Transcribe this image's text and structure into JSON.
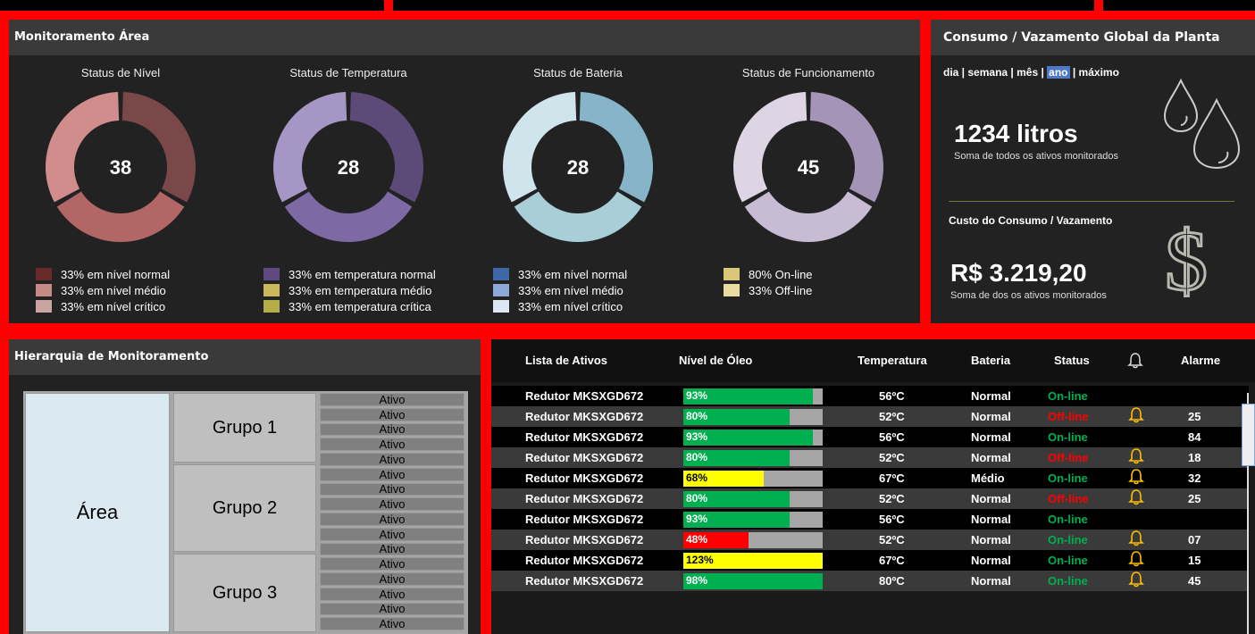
{
  "monitor": {
    "title": "Monitoramento Área",
    "donuts": [
      {
        "title": "Status de Nível",
        "center": "38",
        "segments": [
          {
            "value": 33,
            "color": "#7a4848"
          },
          {
            "value": 33,
            "color": "#b36666"
          },
          {
            "value": 33,
            "color": "#d18c8c"
          }
        ],
        "legend": [
          {
            "label": "33% em nível normal",
            "color": "#6a2a2a"
          },
          {
            "label": "33% em nível médio",
            "color": "#c48a84"
          },
          {
            "label": "33% em nível crítico",
            "color": "#c9a4a0"
          }
        ]
      },
      {
        "title": "Status de Temperatura",
        "center": "28",
        "segments": [
          {
            "value": 33,
            "color": "#5c4a78"
          },
          {
            "value": 33,
            "color": "#7d6aa5"
          },
          {
            "value": 33,
            "color": "#a696c6"
          }
        ],
        "legend": [
          {
            "label": "33% em temperatura normal",
            "color": "#5e4a80"
          },
          {
            "label": "33% em temperatura médio",
            "color": "#cdb75c"
          },
          {
            "label": "33% em temperatura crítica",
            "color": "#b5ac4a"
          }
        ]
      },
      {
        "title": "Status de Bateria",
        "center": "28",
        "segments": [
          {
            "value": 33,
            "color": "#87b4c8"
          },
          {
            "value": 33,
            "color": "#a8cfd7"
          },
          {
            "value": 33,
            "color": "#d0e4ec"
          }
        ],
        "legend": [
          {
            "label": "33% em nível normal",
            "color": "#3f67a6"
          },
          {
            "label": "33% em nível médio",
            "color": "#8ca8d6"
          },
          {
            "label": "33% em nível crítico",
            "color": "#dde6f3"
          }
        ]
      },
      {
        "title": "Status de Funcionamento",
        "center": "45",
        "segments": [
          {
            "value": 33,
            "color": "#a494b8"
          },
          {
            "value": 33,
            "color": "#c8bcd4"
          },
          {
            "value": 33,
            "color": "#ddd4e4"
          }
        ],
        "legend": [
          {
            "label": "80% On-line",
            "color": "#d9c77a"
          },
          {
            "label": "33% Off-line",
            "color": "#e8dca0"
          }
        ]
      }
    ]
  },
  "consumption": {
    "title": "Consumo / Vazamento Global da Planta",
    "periods": [
      "dia",
      "semana",
      "mês",
      "ano",
      "máximo"
    ],
    "active_period": "ano",
    "volume": "1234 litros",
    "volume_caption": "Soma de todos os ativos monitorados",
    "cost_title": "Custo do Consumo / Vazamento",
    "cost": "R$ 3.219,20",
    "cost_caption": "Soma de dos os ativos monitorados"
  },
  "hierarchy": {
    "title": "Hierarquia de Monitoramento",
    "area": "Área",
    "groups": [
      "Grupo 1",
      "Grupo 2",
      "Grupo 3"
    ],
    "asset_label": "Ativo"
  },
  "list": {
    "headers": {
      "assets": "Lista de Ativos",
      "oil": "Nível de Óleo",
      "temp": "Temperatura",
      "battery": "Bateria",
      "status": "Status",
      "alarm": "Alarme"
    },
    "rows": [
      {
        "name": "Redutor MKSXGD672",
        "oil": "93%",
        "oil_pct": 0.93,
        "oil_color": "#00b050",
        "temp": "56ºC",
        "battery": "Normal",
        "status": "On-line",
        "status_color": "#00b050",
        "bell": false,
        "alarm": ""
      },
      {
        "name": "Redutor MKSXGD672",
        "oil": "80%",
        "oil_pct": 0.76,
        "oil_color": "#00b050",
        "temp": "52ºC",
        "battery": "Normal",
        "status": "Off-line",
        "status_color": "#ff0000",
        "bell": true,
        "alarm": "25"
      },
      {
        "name": "Redutor MKSXGD672",
        "oil": "93%",
        "oil_pct": 0.93,
        "oil_color": "#00b050",
        "temp": "56ºC",
        "battery": "Normal",
        "status": "On-line",
        "status_color": "#00b050",
        "bell": false,
        "alarm": "84"
      },
      {
        "name": "Redutor MKSXGD672",
        "oil": "80%",
        "oil_pct": 0.76,
        "oil_color": "#00b050",
        "temp": "52ºC",
        "battery": "Normal",
        "status": "Off-line",
        "status_color": "#ff0000",
        "bell": true,
        "alarm": "18"
      },
      {
        "name": "Redutor MKSXGD672",
        "oil": "68%",
        "oil_pct": 0.58,
        "oil_color": "#ffff00",
        "temp": "67ºC",
        "battery": "Médio",
        "status": "On-line",
        "status_color": "#00b050",
        "bell": true,
        "alarm": "32"
      },
      {
        "name": "Redutor MKSXGD672",
        "oil": "80%",
        "oil_pct": 0.76,
        "oil_color": "#00b050",
        "temp": "52ºC",
        "battery": "Normal",
        "status": "Off-line",
        "status_color": "#ff0000",
        "bell": true,
        "alarm": "25"
      },
      {
        "name": "Redutor MKSXGD672",
        "oil": "93%",
        "oil_pct": 0.76,
        "oil_color": "#00b050",
        "temp": "56ºC",
        "battery": "Normal",
        "status": "On-line",
        "status_color": "#00b050",
        "bell": false,
        "alarm": ""
      },
      {
        "name": "Redutor MKSXGD672",
        "oil": "48%",
        "oil_pct": 0.47,
        "oil_color": "#ff0000",
        "temp": "52ºC",
        "battery": "Normal",
        "status": "On-line",
        "status_color": "#00b050",
        "bell": true,
        "alarm": "07"
      },
      {
        "name": "Redutor MKSXGD672",
        "oil": "123%",
        "oil_pct": 1.0,
        "oil_color": "#ffff00",
        "temp": "67ºC",
        "battery": "Normal",
        "status": "On-line",
        "status_color": "#00b050",
        "bell": true,
        "alarm": "15"
      },
      {
        "name": "Redutor MKSXGD672",
        "oil": "98%",
        "oil_pct": 1.0,
        "oil_color": "#00b050",
        "temp": "80ºC",
        "battery": "Normal",
        "status": "On-line",
        "status_color": "#00b050",
        "bell": true,
        "alarm": "45"
      }
    ]
  }
}
